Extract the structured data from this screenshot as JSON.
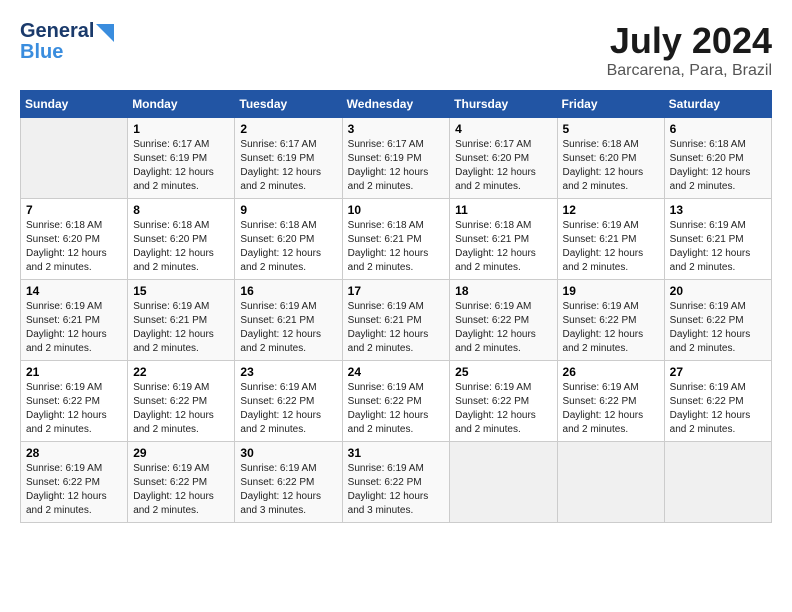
{
  "header": {
    "logo_general": "General",
    "logo_blue": "Blue",
    "month_year": "July 2024",
    "location": "Barcarena, Para, Brazil"
  },
  "days_of_week": [
    "Sunday",
    "Monday",
    "Tuesday",
    "Wednesday",
    "Thursday",
    "Friday",
    "Saturday"
  ],
  "weeks": [
    [
      {
        "day": "",
        "info": ""
      },
      {
        "day": "1",
        "info": "Sunrise: 6:17 AM\nSunset: 6:19 PM\nDaylight: 12 hours and 2 minutes."
      },
      {
        "day": "2",
        "info": "Sunrise: 6:17 AM\nSunset: 6:19 PM\nDaylight: 12 hours and 2 minutes."
      },
      {
        "day": "3",
        "info": "Sunrise: 6:17 AM\nSunset: 6:19 PM\nDaylight: 12 hours and 2 minutes."
      },
      {
        "day": "4",
        "info": "Sunrise: 6:17 AM\nSunset: 6:20 PM\nDaylight: 12 hours and 2 minutes."
      },
      {
        "day": "5",
        "info": "Sunrise: 6:18 AM\nSunset: 6:20 PM\nDaylight: 12 hours and 2 minutes."
      },
      {
        "day": "6",
        "info": "Sunrise: 6:18 AM\nSunset: 6:20 PM\nDaylight: 12 hours and 2 minutes."
      }
    ],
    [
      {
        "day": "7",
        "info": "Sunrise: 6:18 AM\nSunset: 6:20 PM\nDaylight: 12 hours and 2 minutes."
      },
      {
        "day": "8",
        "info": "Sunrise: 6:18 AM\nSunset: 6:20 PM\nDaylight: 12 hours and 2 minutes."
      },
      {
        "day": "9",
        "info": "Sunrise: 6:18 AM\nSunset: 6:20 PM\nDaylight: 12 hours and 2 minutes."
      },
      {
        "day": "10",
        "info": "Sunrise: 6:18 AM\nSunset: 6:21 PM\nDaylight: 12 hours and 2 minutes."
      },
      {
        "day": "11",
        "info": "Sunrise: 6:18 AM\nSunset: 6:21 PM\nDaylight: 12 hours and 2 minutes."
      },
      {
        "day": "12",
        "info": "Sunrise: 6:19 AM\nSunset: 6:21 PM\nDaylight: 12 hours and 2 minutes."
      },
      {
        "day": "13",
        "info": "Sunrise: 6:19 AM\nSunset: 6:21 PM\nDaylight: 12 hours and 2 minutes."
      }
    ],
    [
      {
        "day": "14",
        "info": "Sunrise: 6:19 AM\nSunset: 6:21 PM\nDaylight: 12 hours and 2 minutes."
      },
      {
        "day": "15",
        "info": "Sunrise: 6:19 AM\nSunset: 6:21 PM\nDaylight: 12 hours and 2 minutes."
      },
      {
        "day": "16",
        "info": "Sunrise: 6:19 AM\nSunset: 6:21 PM\nDaylight: 12 hours and 2 minutes."
      },
      {
        "day": "17",
        "info": "Sunrise: 6:19 AM\nSunset: 6:21 PM\nDaylight: 12 hours and 2 minutes."
      },
      {
        "day": "18",
        "info": "Sunrise: 6:19 AM\nSunset: 6:22 PM\nDaylight: 12 hours and 2 minutes."
      },
      {
        "day": "19",
        "info": "Sunrise: 6:19 AM\nSunset: 6:22 PM\nDaylight: 12 hours and 2 minutes."
      },
      {
        "day": "20",
        "info": "Sunrise: 6:19 AM\nSunset: 6:22 PM\nDaylight: 12 hours and 2 minutes."
      }
    ],
    [
      {
        "day": "21",
        "info": "Sunrise: 6:19 AM\nSunset: 6:22 PM\nDaylight: 12 hours and 2 minutes."
      },
      {
        "day": "22",
        "info": "Sunrise: 6:19 AM\nSunset: 6:22 PM\nDaylight: 12 hours and 2 minutes."
      },
      {
        "day": "23",
        "info": "Sunrise: 6:19 AM\nSunset: 6:22 PM\nDaylight: 12 hours and 2 minutes."
      },
      {
        "day": "24",
        "info": "Sunrise: 6:19 AM\nSunset: 6:22 PM\nDaylight: 12 hours and 2 minutes."
      },
      {
        "day": "25",
        "info": "Sunrise: 6:19 AM\nSunset: 6:22 PM\nDaylight: 12 hours and 2 minutes."
      },
      {
        "day": "26",
        "info": "Sunrise: 6:19 AM\nSunset: 6:22 PM\nDaylight: 12 hours and 2 minutes."
      },
      {
        "day": "27",
        "info": "Sunrise: 6:19 AM\nSunset: 6:22 PM\nDaylight: 12 hours and 2 minutes."
      }
    ],
    [
      {
        "day": "28",
        "info": "Sunrise: 6:19 AM\nSunset: 6:22 PM\nDaylight: 12 hours and 2 minutes."
      },
      {
        "day": "29",
        "info": "Sunrise: 6:19 AM\nSunset: 6:22 PM\nDaylight: 12 hours and 2 minutes."
      },
      {
        "day": "30",
        "info": "Sunrise: 6:19 AM\nSunset: 6:22 PM\nDaylight: 12 hours and 3 minutes."
      },
      {
        "day": "31",
        "info": "Sunrise: 6:19 AM\nSunset: 6:22 PM\nDaylight: 12 hours and 3 minutes."
      },
      {
        "day": "",
        "info": ""
      },
      {
        "day": "",
        "info": ""
      },
      {
        "day": "",
        "info": ""
      }
    ]
  ]
}
